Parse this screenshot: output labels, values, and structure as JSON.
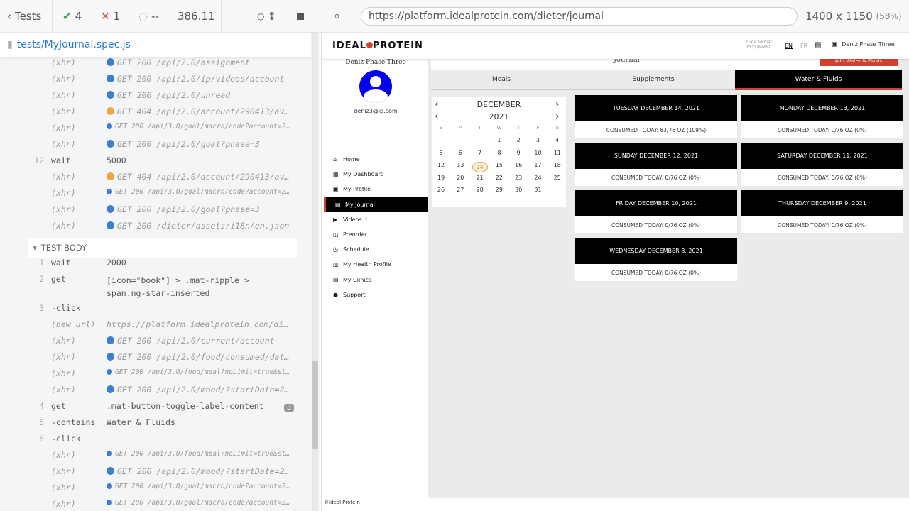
{
  "runner": {
    "tests_label": "Tests",
    "passed": "4",
    "failed": "1",
    "pending": "--",
    "time": "386.11",
    "url": "https://platform.idealprotein.com/dieter/journal",
    "viewport": "1400 x 1150",
    "scale": "(58%)",
    "spec_file": "tests/MyJournal.spec.js",
    "test_body_label": "TEST BODY"
  },
  "commands": [
    {
      "num": "",
      "name": "(xhr)",
      "msg": "GET 200 /api/2.0/assignment",
      "dot": "b"
    },
    {
      "num": "",
      "name": "(xhr)",
      "msg": "GET 200 /api/2.0/ip/videos/account",
      "dot": "b"
    },
    {
      "num": "",
      "name": "(xhr)",
      "msg": "GET 200 /api/2.0/unread",
      "dot": "b"
    },
    {
      "num": "",
      "name": "(xhr)",
      "msg": "GET 404 /api/2.0/account/290413/avatar",
      "dot": "o"
    },
    {
      "num": "",
      "name": "(xhr)",
      "msg": "GET 200 /api/3.0/goal/macro/code?account=290413",
      "dot": "s"
    },
    {
      "num": "",
      "name": "(xhr)",
      "msg": "GET 200 /api/2.0/goal?phase=3",
      "dot": "b"
    },
    {
      "num": "12",
      "name": "wait",
      "msg": "5000",
      "dot": ""
    },
    {
      "num": "",
      "name": "(xhr)",
      "msg": "GET 404 /api/2.0/account/290413/avatar",
      "dot": "o"
    },
    {
      "num": "",
      "name": "(xhr)",
      "msg": "GET 200 /api/3.0/goal/macro/code?account=290413",
      "dot": "s"
    },
    {
      "num": "",
      "name": "(xhr)",
      "msg": "GET 200 /api/2.0/goal?phase=3",
      "dot": "b"
    },
    {
      "num": "",
      "name": "(xhr)",
      "msg": "GET 200 /dieter/assets/i18n/en.json",
      "dot": "b"
    }
  ],
  "body_commands": [
    {
      "num": "1",
      "name": "wait",
      "msg": "2000",
      "dot": ""
    },
    {
      "num": "2",
      "name": "get",
      "msg": "[icon=\"book\"] > .mat-ripple > span.ng-star-inserted",
      "dot": "",
      "tall": true
    },
    {
      "num": "3",
      "name": "-click",
      "msg": "",
      "dot": ""
    },
    {
      "num": "",
      "name": "(new url)",
      "msg": "https://platform.idealprotein.com/dieter/journal",
      "dot": ""
    },
    {
      "num": "",
      "name": "(xhr)",
      "msg": "GET 200 /api/2.0/current/account",
      "dot": "b"
    },
    {
      "num": "",
      "name": "(xhr)",
      "msg": "GET 200 /api/2.0/food/consumed/dates?start",
      "dot": "b"
    },
    {
      "num": "",
      "name": "(xhr)",
      "msg": "GET 200 /api/3.0/food/meal?noLimit=true&startDate",
      "dot": "s"
    },
    {
      "num": "",
      "name": "(xhr)",
      "msg": "GET 200 /api/2.0/mood/?startDate=2021",
      "dot": "b"
    },
    {
      "num": "4",
      "name": "get",
      "msg": ".mat-button-toggle-label-content",
      "dot": "",
      "badge": "3"
    },
    {
      "num": "5",
      "name": "-contains",
      "msg": "Water & Fluids",
      "dot": ""
    },
    {
      "num": "6",
      "name": "-click",
      "msg": "",
      "dot": ""
    },
    {
      "num": "",
      "name": "(xhr)",
      "msg": "GET 200 /api/3.0/food/meal?noLimit=true&startDate",
      "dot": "s"
    },
    {
      "num": "",
      "name": "(xhr)",
      "msg": "GET 200 /api/2.0/mood/?startDate=2021",
      "dot": "b"
    },
    {
      "num": "",
      "name": "(xhr)",
      "msg": "GET 200 /api/3.0/goal/macro/code?account=290413",
      "dot": "s"
    },
    {
      "num": "",
      "name": "(xhr)",
      "msg": "GET 200 /api/3.0/goal/macro/code?account=290413",
      "dot": "s"
    }
  ],
  "app": {
    "logo": "IDEAL PROTEIN",
    "date_format_label": "Date format:",
    "date_format": "YYYY/MM/DD",
    "lang_en": "EN",
    "lang_fr": "FR",
    "user_name": "Deniz Phase Three",
    "email": "deniz3@ip.com",
    "page_title": "Journal",
    "add_button": "Add Water & Fluids",
    "nav": [
      {
        "label": "Home",
        "icon": "home-icon"
      },
      {
        "label": "My Dashboard",
        "icon": "dashboard-icon"
      },
      {
        "label": "My Profile",
        "icon": "profile-icon"
      },
      {
        "label": "My Journal",
        "icon": "book-icon"
      },
      {
        "label": "Videos",
        "icon": "video-icon"
      },
      {
        "label": "Preorder",
        "icon": "cart-icon"
      },
      {
        "label": "Schedule",
        "icon": "clock-icon"
      },
      {
        "label": "My Health Profile",
        "icon": "chart-icon"
      },
      {
        "label": "My Clinics",
        "icon": "clinic-icon"
      },
      {
        "label": "Support",
        "icon": "help-icon"
      }
    ],
    "tabs": [
      "Meals",
      "Supplements",
      "Water & Fluids"
    ],
    "calendar": {
      "month": "DECEMBER",
      "year": "2021",
      "weekdays": [
        "S",
        "M",
        "T",
        "W",
        "T",
        "F",
        "S"
      ],
      "today": "14"
    },
    "cards": [
      {
        "title": "TUESDAY DECEMBER 14, 2021",
        "consumed": "CONSUMED TODAY: 83/76 OZ (109%)"
      },
      {
        "title": "MONDAY DECEMBER 13, 2021",
        "consumed": "CONSUMED TODAY: 0/76 OZ (0%)"
      },
      {
        "title": "SUNDAY DECEMBER 12, 2021",
        "consumed": "CONSUMED TODAY: 0/76 OZ (0%)"
      },
      {
        "title": "SATURDAY DECEMBER 11, 2021",
        "consumed": "CONSUMED TODAY: 0/76 OZ (0%)"
      },
      {
        "title": "FRIDAY DECEMBER 10, 2021",
        "consumed": "CONSUMED TODAY: 0/76 OZ (0%)"
      },
      {
        "title": "THURSDAY DECEMBER 9, 2021",
        "consumed": "CONSUMED TODAY: 0/76 OZ (0%)"
      },
      {
        "title": "WEDNESDAY DECEMBER 8, 2021",
        "consumed": "CONSUMED TODAY: 0/76 OZ (0%)"
      }
    ],
    "footer": "©Ideal Protein",
    "colors": {
      "accent": "#d4402f",
      "active_bg": "#000000",
      "link": "#2a7bd4"
    }
  }
}
